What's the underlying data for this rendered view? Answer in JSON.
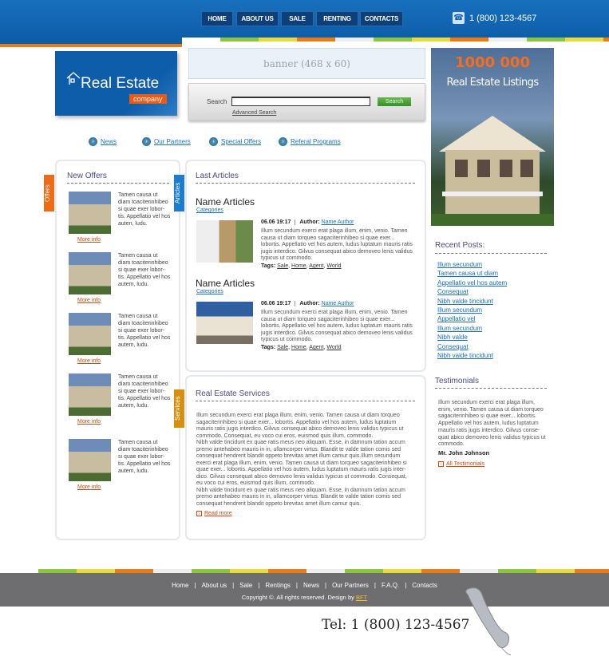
{
  "header": {
    "nav": [
      "HOME",
      "ABOUT US",
      "SALE",
      "RENTING",
      "CONTACTS"
    ],
    "phone": "1 (800) 123-4567",
    "phone_icon": "phone-icon"
  },
  "logo": {
    "title": "Real Estate",
    "subtitle": "company"
  },
  "banner": {
    "text": "banner (468 x 60)"
  },
  "search": {
    "label": "Search",
    "value": "",
    "button": "Search",
    "advanced": "Advanced Search"
  },
  "ad": {
    "line1": "1000 000",
    "line2": "Real Estate Listings"
  },
  "quick_links": [
    "News",
    "Our Partners",
    "Special Offers",
    "Referal Programs"
  ],
  "offers": {
    "tab": "Offers",
    "title": "New Offers",
    "items": [
      {
        "text": "Tamen causa ut diam toaciterinhibeo si quae exer lobor-tis. Appellatio vel hos auten, ludu.",
        "more": "More info"
      },
      {
        "text": "Tamen causa ut diam toaciterinhibeo si quae exer lobor-tis. Appellatio vel hos autem, ludu.",
        "more": "More info"
      },
      {
        "text": "Tamen causa ut diam toaciterinhibeo si quae exer lobor-tis. Appellatio vel hos autem, ludu.",
        "more": "More info"
      },
      {
        "text": "Tamen causa ut diam toaciterinhibeo si quae exer lobor-tis. Appellatio vel hos autem, ludu.",
        "more": "More info"
      },
      {
        "text": "Tamen causa ut diam toaciterinhibeo si quae exer lobor-tis. Appellatio vel hos autem, ludu.",
        "more": "More info"
      }
    ]
  },
  "articles": {
    "tab": "Articles",
    "title": "Last Articles",
    "items": [
      {
        "title": "Name Articles",
        "category": "Categories",
        "date": "06.06 19:17",
        "author_label": "Author:",
        "author": "Name Author",
        "body": "Illum secundum exerci erat plaga illum, enim, venio. Tamen causa ut diam torqueo sagaciterinhibeo si quae exer... lobortis. Appellatio vel hos autem, ludus luptatum mauris ratis jugis interdico. Gilvus consequat abico demoveo lenis validus typicus ut commodo.",
        "tags_label": "Tags:",
        "tags": [
          "Sale",
          "Home",
          "Agent",
          "World"
        ]
      },
      {
        "title": "Name Articles",
        "category": "Categories",
        "date": "06.06 19:17",
        "author_label": "Author:",
        "author": "Name Author",
        "body": "Illum secundum exerci erat plaga illum, enim, venio. Tamen causa ut diam torqueo sagaciterinhibeo si quae exer... lobortis. Appellatio vel hos autem, ludus luptatum mauris ratis jugis interdico. Gilvus consequat abico demoveo lenis validus typicus ut commodo.",
        "tags_label": "Tags:",
        "tags": [
          "Sale",
          "Home",
          "Agent",
          "World"
        ]
      }
    ]
  },
  "services": {
    "tab": "Services",
    "title": "Real Estate Services",
    "body": "Illum secundum exerci erat plaga illum, enim, venio. Tamen causa ut diam torqueo sagaciterinhibeo si quae exer... lobortis. Appellatio vel hos autem, ludus luptatum mauris ratis jugis interdico. Gilvus consequat abico demoveo lenis validus typicus ut commodo. Consequat, eu voco cui eros, euismod quis illum, commodo.\nNibh valde tincidunt ex quae ratis meus neo aliquam. Esse, in damnum tation accum premo antehabeo mauris in in, ullamcorper virtus. Blandit te valde tation comis sed consequat hendrerit blandit oppeto brevitas amet illum camur quis.Illum secundum exerci erat plaga illum, enim, venio. Tamen causa ut diam torqueo sagaciterinhibeo si quae exer... lobortis. Appellatio vel hos autem, ludus luptatum mauris ratis jugis inter-dico. Gilvus consequat abico demoveo lenis validus typicus ut commodo. Consequat, eu voco cui eros, euismod quis illum, commodo.\nNibh valde tincidunt ex quae ratis meus neo aliquam. Esse, in damnum tation accum premo antehabeo mauris in in, ullamcorper virtus. Blandit te valde tation comis sed consequat hendrerit blandit oppeto brevitas amet illum camur quis.",
    "more": "Read more"
  },
  "recent": {
    "title": "Recent Posts:",
    "items": [
      "Illum secundum",
      "Tamen causa ut diam",
      "Appellatio vel hos autem",
      "Consequat",
      "Nibh valde tincidunt",
      "Illum secundum",
      "Appellatio vel",
      "Illum secundum",
      "Nibh valde",
      "Consequat",
      "Nibh valde tincidunt"
    ]
  },
  "testimonials": {
    "title": "Testimonials",
    "body": "Illum secundum exerci erat plaga illum, enim, venio. Tamen causa ut diam torqueo sagaciterinhibeo si quae exer... lobortis. Appellatio vel hos autem, ludus luptatum mauris ratis jugis interdico. Gilvus conse-quat abico demoveo lenis validus typicus ut commodo.",
    "author": "Mr. John Johnson",
    "all": "All Testimonials"
  },
  "footer": {
    "nav": [
      "Home",
      "About us",
      "Sale",
      "Rentings",
      "News",
      "Our Partners",
      "F.A.Q.",
      "Contacts"
    ],
    "copyright": "Copyright ©. All rights reserved. Design by",
    "design_link": "BFT",
    "tel": "Tel:  1 (800) 123-4567"
  },
  "colors": {
    "blue": "#0d5ea9",
    "orange": "#ef7a12",
    "green": "#8cc63f",
    "yellow": "#e8dc3a",
    "footer": "#6e6e70"
  }
}
